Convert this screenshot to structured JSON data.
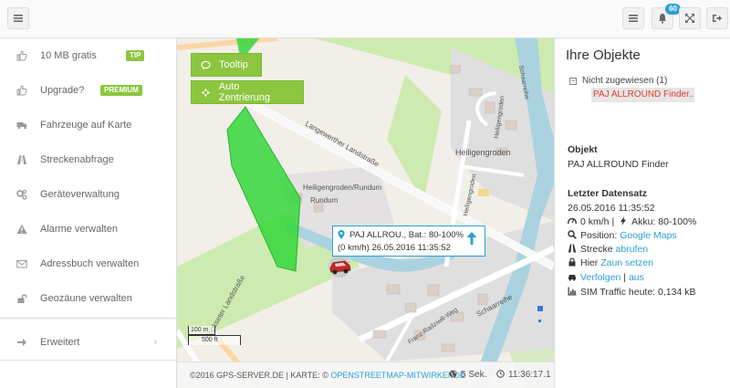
{
  "header": {
    "notifications_count": "60",
    "icons": [
      "menu-icon",
      "list-icon",
      "bell-icon",
      "expand-icon",
      "logout-icon"
    ]
  },
  "sidebar": {
    "items": [
      {
        "label": "10 MB gratis",
        "tag": "TIP",
        "icon": "thumbs-up-icon"
      },
      {
        "label": "Upgrade?",
        "tag": "PREMIUM",
        "icon": "thumbs-up-icon"
      },
      {
        "label": "Fahrzeuge auf Karte",
        "icon": "truck-icon"
      },
      {
        "label": "Streckenabfrage",
        "icon": "road-icon"
      },
      {
        "label": "Geräteverwaltung",
        "icon": "cogs-icon"
      },
      {
        "label": "Alarme verwalten",
        "icon": "warning-icon"
      },
      {
        "label": "Adressbuch verwalten",
        "icon": "envelope-icon"
      },
      {
        "label": "Geozäune verwalten",
        "icon": "lock-icon"
      },
      {
        "label": "Erweitert",
        "icon": "arrow-right-icon"
      }
    ],
    "accent": "#8cc63f"
  },
  "map": {
    "buttons": {
      "tooltip": "Tooltip",
      "center": "Auto Zentrierung"
    },
    "labels": {
      "road1": "Langewerther Landstraße",
      "road2": "Hookseter Landstraße",
      "road3": "Schaarreihe",
      "road4": "Heiligengroden",
      "road5": "Heiligengroden",
      "area1": "Heiligengroden/Rundum",
      "area2": "Rundum",
      "road6": "Franz-Radziwill-Weg",
      "road7": "Schaarreihe",
      "road8": "Heiligengroden"
    },
    "popup": {
      "line1": "PAJ ALLROU., Bat.: 80-100%",
      "line2": "(0 km/h) 26.05.2016 11:35:52"
    },
    "scale": {
      "m": "100 m",
      "ft": "500 ft"
    },
    "footer": {
      "copyright": "©2016 GPS-SERVER.DE | KARTE: ©",
      "osm": "OPENSTREETMAP-MITWIRKENDE",
      "update": "5 Sek.",
      "clock": "11:36:17.1"
    }
  },
  "right": {
    "title": "Ihre Objekte",
    "group": "Nicht zugewiesen (1)",
    "object": "PAJ ALLROUND Finder...",
    "objekt_h": "Objekt",
    "objekt_name": "PAJ ALLROUND Finder",
    "data_h": "Letzter Datensatz",
    "timestamp": "26.05.2016 11:35:52",
    "speed": "0 km/h",
    "sep": "|",
    "battery": "Akku: 80-100%",
    "position_label": "Position:",
    "position_link": "Google Maps",
    "strecke_label": "Strecke",
    "strecke_link": "abrufen",
    "zaun_label": "Hier",
    "zaun_link": "Zaun setzen",
    "follow_link": "Verfolgen",
    "off_link": "aus",
    "sim": "SIM Traffic heute: 0,134 kB"
  }
}
